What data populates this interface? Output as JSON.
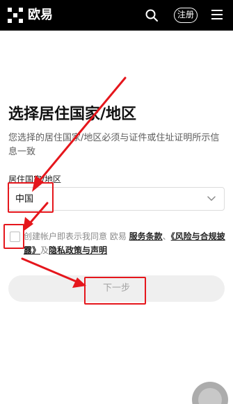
{
  "header": {
    "brand": "欧易",
    "register_label": "注册",
    "icons": {
      "logo": "okx-logo-icon",
      "search": "search-icon",
      "menu": "menu-icon"
    }
  },
  "page": {
    "title": "选择居住国家/地区",
    "description": "您选择的居住国家/地区必须与证件或住址证明所示信息一致"
  },
  "form": {
    "country_label": "居住国家/地区",
    "country_value": "中国"
  },
  "agreement": {
    "prefix": "创建帐户即表示我同意 欧易 ",
    "terms_link": "服务条款",
    "separator": "、",
    "risk_link": "《风险与合规披露》",
    "and": "及",
    "privacy_link": "隐私政策与声明",
    "checked": false
  },
  "actions": {
    "next_label": "下一步"
  },
  "colors": {
    "header_bg": "#000000",
    "annotation_red": "#e5161c",
    "disabled_button_bg": "#efefef",
    "disabled_button_text": "#a3a3a3"
  }
}
